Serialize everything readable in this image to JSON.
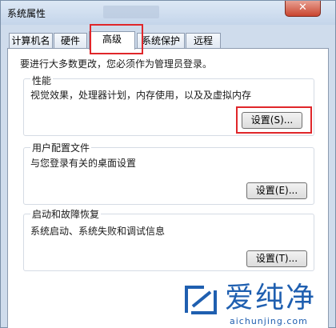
{
  "window": {
    "title": "系统属性",
    "close_symbol": "✕"
  },
  "tabs": [
    {
      "label": "计算机名",
      "active": false
    },
    {
      "label": "硬件",
      "active": false
    },
    {
      "label": "高级",
      "active": true
    },
    {
      "label": "系统保护",
      "active": false
    },
    {
      "label": "远程",
      "active": false
    }
  ],
  "intro": "要进行大多数更改，您必须作为管理员登录。",
  "groups": {
    "performance": {
      "title": "性能",
      "desc": "视觉效果，处理器计划，内存使用，以及及虚拟内存",
      "button": "设置(S)..."
    },
    "user_profiles": {
      "title": "用户配置文件",
      "desc": "与您登录有关的桌面设置",
      "button": "设置(E)..."
    },
    "startup_recovery": {
      "title": "启动和故障恢复",
      "desc": "系统启动、系统失败和调试信息",
      "button": "设置(T)..."
    }
  },
  "watermark": {
    "brand": "爱纯净",
    "url": "aichunjing.com"
  },
  "colors": {
    "highlight": "#e0262a",
    "brand": "#1f5fb0"
  }
}
